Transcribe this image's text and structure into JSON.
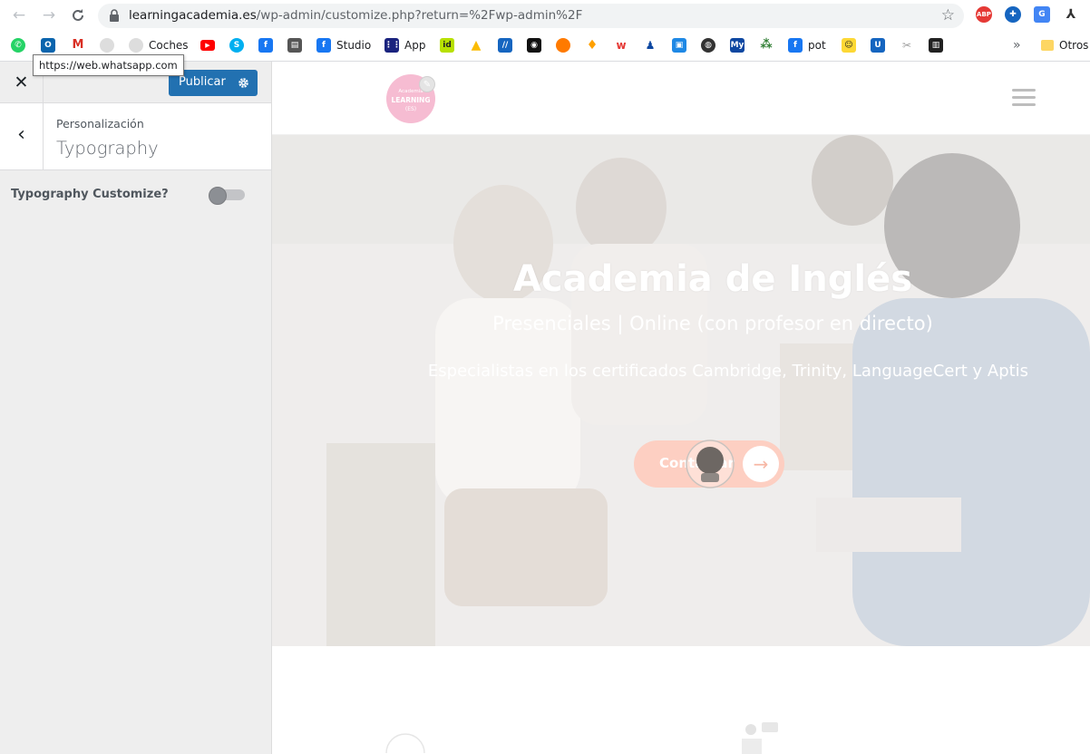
{
  "browser": {
    "url_host": "learningacademia.es",
    "url_path": "/wp-admin/customize.php?return=%2Fwp-admin%2F",
    "tooltip": "https://web.whatsapp.com",
    "bookmarks": [
      {
        "label": "",
        "icon": "whatsapp-icon",
        "color": "#25d366"
      },
      {
        "label": "",
        "icon": "outlook-icon",
        "color": "#0a64ad"
      },
      {
        "label": "",
        "icon": "gmail-icon",
        "color": "#ffffff"
      },
      {
        "label": "",
        "icon": "site-icon",
        "color": "#c4c4c4"
      },
      {
        "label": "Coches",
        "icon": "site-icon",
        "color": "#c4c4c4"
      },
      {
        "label": "",
        "icon": "youtube-icon",
        "color": "#ff0000"
      },
      {
        "label": "",
        "icon": "skype-icon",
        "color": "#00aff0"
      },
      {
        "label": "",
        "icon": "facebook-icon",
        "color": "#1877f2"
      },
      {
        "label": "",
        "icon": "print-icon",
        "color": "#555555"
      },
      {
        "label": "Studio",
        "icon": "facebook-icon",
        "color": "#1877f2"
      },
      {
        "label": "App",
        "icon": "grid-app-icon",
        "color": "#1a237e"
      },
      {
        "label": "",
        "icon": "id-icon",
        "color": "#b7e000"
      },
      {
        "label": "",
        "icon": "drive-icon",
        "color": "#fbbc04"
      },
      {
        "label": "",
        "icon": "slash-icon",
        "color": "#1565c0"
      },
      {
        "label": "",
        "icon": "dark-site-icon",
        "color": "#111111"
      },
      {
        "label": "",
        "icon": "orange-site-icon",
        "color": "#ff7a00"
      },
      {
        "label": "",
        "icon": "firebase-icon",
        "color": "#ffa000"
      },
      {
        "label": "",
        "icon": "w-icon",
        "color": "#e53935"
      },
      {
        "label": "",
        "icon": "figure-icon",
        "color": "#0d47a1"
      },
      {
        "label": "",
        "icon": "box-icon",
        "color": "#1e88e5"
      },
      {
        "label": "",
        "icon": "globe-icon",
        "color": "#333333"
      },
      {
        "label": "",
        "icon": "my-icon",
        "color": "#0d47a1"
      },
      {
        "label": "",
        "icon": "dots-icon",
        "color": "#2e7d32"
      },
      {
        "label": "pot",
        "icon": "facebook-icon",
        "color": "#1877f2"
      },
      {
        "label": "",
        "icon": "ghost-icon",
        "color": "#fdd835"
      },
      {
        "label": "",
        "icon": "u-icon",
        "color": "#1565c0"
      },
      {
        "label": "",
        "icon": "tools-icon",
        "color": "#9e9e9e"
      },
      {
        "label": "",
        "icon": "square-icon",
        "color": "#212121"
      }
    ],
    "more_label": "»",
    "other_bookmarks": "Otros"
  },
  "sidebar": {
    "publish_label": "Publicar",
    "breadcrumb": "Personalización",
    "section_title": "Typography",
    "option_label": "Typography Customize?"
  },
  "preview": {
    "logo_line1": "Academia",
    "logo_line2": "LEARNING",
    "logo_line3": "(ES)",
    "hero_title": "Academia de Inglés",
    "hero_subtitle": "Presenciales | Online (con profesor en directo)",
    "hero_description": "Especialistas en los certificados Cambridge, Trinity, LanguageCert y Aptis",
    "cta_label": "Contactar"
  },
  "colors": {
    "publish": "#2271b1",
    "sidebar_bg": "#eeeeee",
    "logo_pink": "#f6bcd2",
    "cta_peach": "#ffcbbc"
  }
}
